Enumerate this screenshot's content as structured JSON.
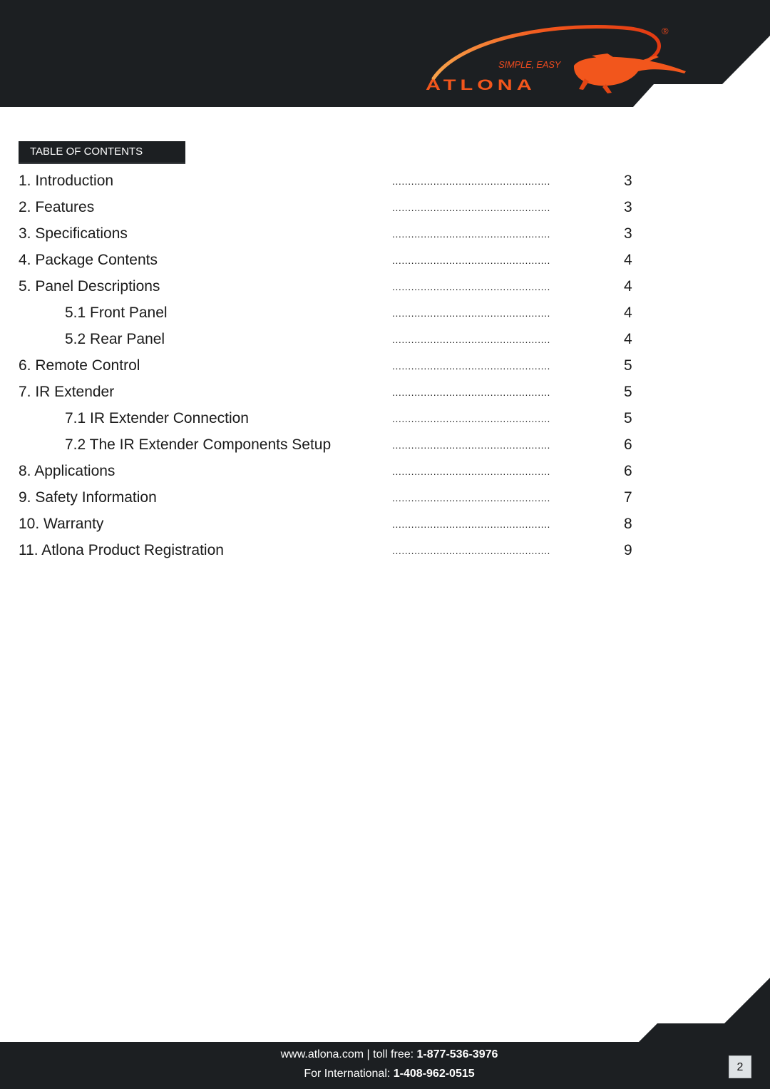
{
  "header": {
    "brand": "ATLONA",
    "tagline": "SIMPLE, EASY",
    "registered_mark": "®",
    "logo_icon": "lizard-icon",
    "colors": {
      "band": "#1c1f22",
      "accent": "#f2561c"
    }
  },
  "toc": {
    "heading": "TABLE OF CONTENTS",
    "leader": "..................................................",
    "entries": [
      {
        "title": "1. Introduction",
        "page": "3",
        "level": 1
      },
      {
        "title": "2. Features",
        "page": "3",
        "level": 1
      },
      {
        "title": "3. Specifications",
        "page": "3",
        "level": 1
      },
      {
        "title": "4. Package Contents",
        "page": "4",
        "level": 1
      },
      {
        "title": "5. Panel Descriptions",
        "page": "4",
        "level": 1
      },
      {
        "title": "5.1 Front Panel",
        "page": "4",
        "level": 2
      },
      {
        "title": "5.2 Rear Panel",
        "page": "4",
        "level": 2
      },
      {
        "title": "6. Remote Control",
        "page": "5",
        "level": 1
      },
      {
        "title": "7. IR Extender",
        "page": "5",
        "level": 1
      },
      {
        "title": "7.1 IR Extender Connection",
        "page": "5",
        "level": 2
      },
      {
        "title": "7.2 The IR Extender Components Setup",
        "page": "6",
        "level": 2
      },
      {
        "title": "8. Applications",
        "page": "6",
        "level": 1
      },
      {
        "title": "9. Safety Information",
        "page": "7",
        "level": 1
      },
      {
        "title": "10. Warranty",
        "page": "8",
        "level": 1
      },
      {
        "title": "11. Atlona Product Registration",
        "page": "9",
        "level": 1
      }
    ]
  },
  "footer": {
    "website": "www.atlona.com",
    "separator": " | ",
    "toll_free_label": "toll free: ",
    "toll_free_number": "1-877-536-3976",
    "international_label": "For International: ",
    "international_number": "1-408-962-0515",
    "page_number": "2"
  }
}
